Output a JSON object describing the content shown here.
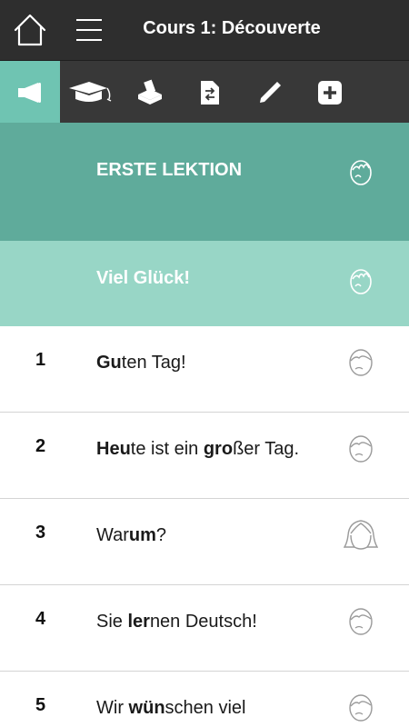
{
  "header": {
    "title": "Cours 1: Découverte"
  },
  "toolbar": {
    "tools": [
      {
        "icon": "megaphone-icon",
        "active": true
      },
      {
        "icon": "graduation-cap-icon",
        "active": false
      },
      {
        "icon": "ballot-box-icon",
        "active": false
      },
      {
        "icon": "document-swap-icon",
        "active": false
      },
      {
        "icon": "pen-icon",
        "active": false
      },
      {
        "icon": "plus-icon",
        "active": false
      }
    ]
  },
  "colors": {
    "header_bg": "#2e2e2e",
    "toolbar_bg": "#383838",
    "active_tool": "#6fc4b2",
    "section_dark": "#5fab9b",
    "section_light": "#98d6c6"
  },
  "sections": [
    {
      "title": "ERSTE LEKTION",
      "icon": "speaking-face-icon"
    },
    {
      "title": "Viel Glück!",
      "icon": "speaking-face-icon"
    }
  ],
  "lessons": [
    {
      "num": "1",
      "parts": [
        {
          "t": "Gu",
          "b": true
        },
        {
          "t": "ten Tag!",
          "b": false
        }
      ],
      "icon": "face-icon"
    },
    {
      "num": "2",
      "parts": [
        {
          "t": "Heu",
          "b": true
        },
        {
          "t": "te ist ein ",
          "b": false
        },
        {
          "t": "gro",
          "b": true
        },
        {
          "t": "ßer Tag.",
          "b": false
        }
      ],
      "icon": "face-icon"
    },
    {
      "num": "3",
      "parts": [
        {
          "t": "War",
          "b": false
        },
        {
          "t": "um",
          "b": true
        },
        {
          "t": "?",
          "b": false
        }
      ],
      "icon": "woman-face-icon"
    },
    {
      "num": "4",
      "parts": [
        {
          "t": "Sie ",
          "b": false
        },
        {
          "t": "ler",
          "b": true
        },
        {
          "t": "nen Deutsch!",
          "b": false
        }
      ],
      "icon": "face-icon"
    },
    {
      "num": "5",
      "parts": [
        {
          "t": "Wir ",
          "b": false
        },
        {
          "t": "wün",
          "b": true
        },
        {
          "t": "schen viel Vergnügen!",
          "b": false
        }
      ],
      "icon": "face-icon"
    }
  ]
}
